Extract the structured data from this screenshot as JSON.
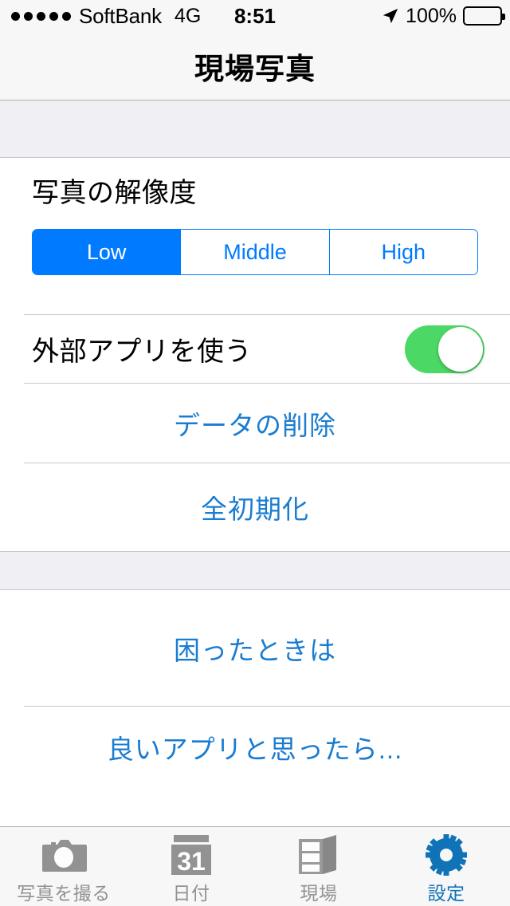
{
  "statusbar": {
    "signal_dots": 5,
    "carrier": "SoftBank",
    "network": "4G",
    "time": "8:51",
    "location_icon": "location-arrow-icon",
    "battery_percent": "100%",
    "battery_level": 100
  },
  "navbar": {
    "title": "現場写真"
  },
  "settings": {
    "resolution": {
      "label": "写真の解像度",
      "options": [
        {
          "label": "Low",
          "selected": true
        },
        {
          "label": "Middle",
          "selected": false
        },
        {
          "label": "High",
          "selected": false
        }
      ]
    },
    "external_app": {
      "label": "外部アプリを使う",
      "enabled": true
    },
    "actions": [
      {
        "label": "データの削除"
      },
      {
        "label": "全初期化"
      }
    ],
    "support": [
      {
        "label": "困ったときは"
      },
      {
        "label": "良いアプリと思ったら..."
      }
    ]
  },
  "tabbar": {
    "tabs": [
      {
        "label": "写真を撮る",
        "icon": "camera-icon",
        "active": false
      },
      {
        "label": "日付",
        "icon": "calendar-icon",
        "icon_day": "31",
        "active": false
      },
      {
        "label": "現場",
        "icon": "site-building-icon",
        "active": false
      },
      {
        "label": "設定",
        "icon": "gear-icon",
        "active": true
      }
    ]
  },
  "colors": {
    "tint_blue": "#007aff",
    "link_blue": "#1a7cd1",
    "tab_active_blue": "#1073b8",
    "switch_green": "#4cd864",
    "group_bg": "#efeff4",
    "bar_bg": "#f7f7f7",
    "separator": "#c8c7cc",
    "inactive_gray": "#929292"
  }
}
